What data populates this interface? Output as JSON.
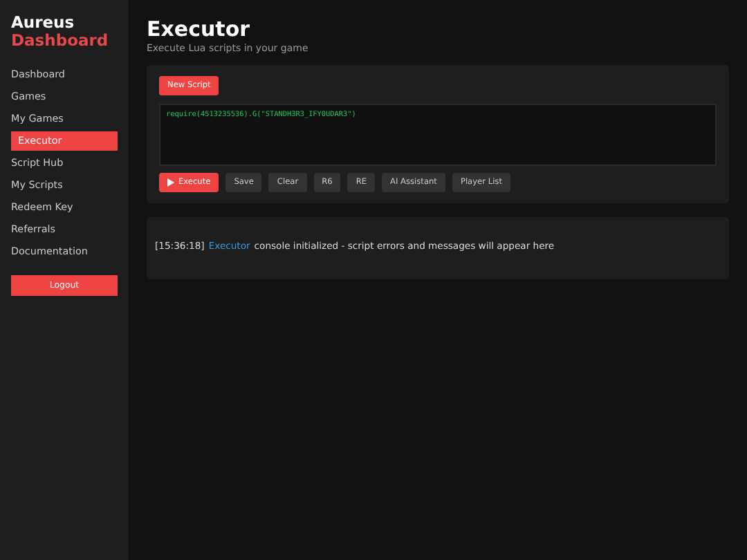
{
  "brand": {
    "line_1": "Aureus",
    "line_2": "Dashboard"
  },
  "sidebar": {
    "items": [
      {
        "label": "Dashboard",
        "selected": false
      },
      {
        "label": "Games",
        "selected": false
      },
      {
        "label": "My Games",
        "selected": false
      },
      {
        "label": "Executor",
        "selected": true
      },
      {
        "label": "Script Hub",
        "selected": false
      },
      {
        "label": "My Scripts",
        "selected": false
      },
      {
        "label": "Redeem Key",
        "selected": false
      },
      {
        "label": "Referrals",
        "selected": false
      },
      {
        "label": "Documentation",
        "selected": false
      }
    ],
    "logout": "Logout"
  },
  "page": {
    "title": "Executor",
    "subtitle": "Execute Lua scripts in your game"
  },
  "editor": {
    "new_script": "New Script",
    "code": "require(4513235536).G(\"STANDH3R3_IFY0UDAR3\")",
    "buttons": [
      {
        "label": "Execute",
        "kind": "primary"
      },
      {
        "label": "Save",
        "kind": "secondary"
      },
      {
        "label": "Clear",
        "kind": "secondary"
      },
      {
        "label": "R6",
        "kind": "secondary"
      },
      {
        "label": "RE",
        "kind": "secondary"
      },
      {
        "label": "AI Assistant",
        "kind": "secondary"
      },
      {
        "label": "Player List",
        "kind": "secondary"
      }
    ]
  },
  "console": {
    "lines": [
      {
        "time": "[15:36:18]",
        "source": "Executor",
        "message": "console initialized - script errors and messages will appear here"
      }
    ]
  }
}
